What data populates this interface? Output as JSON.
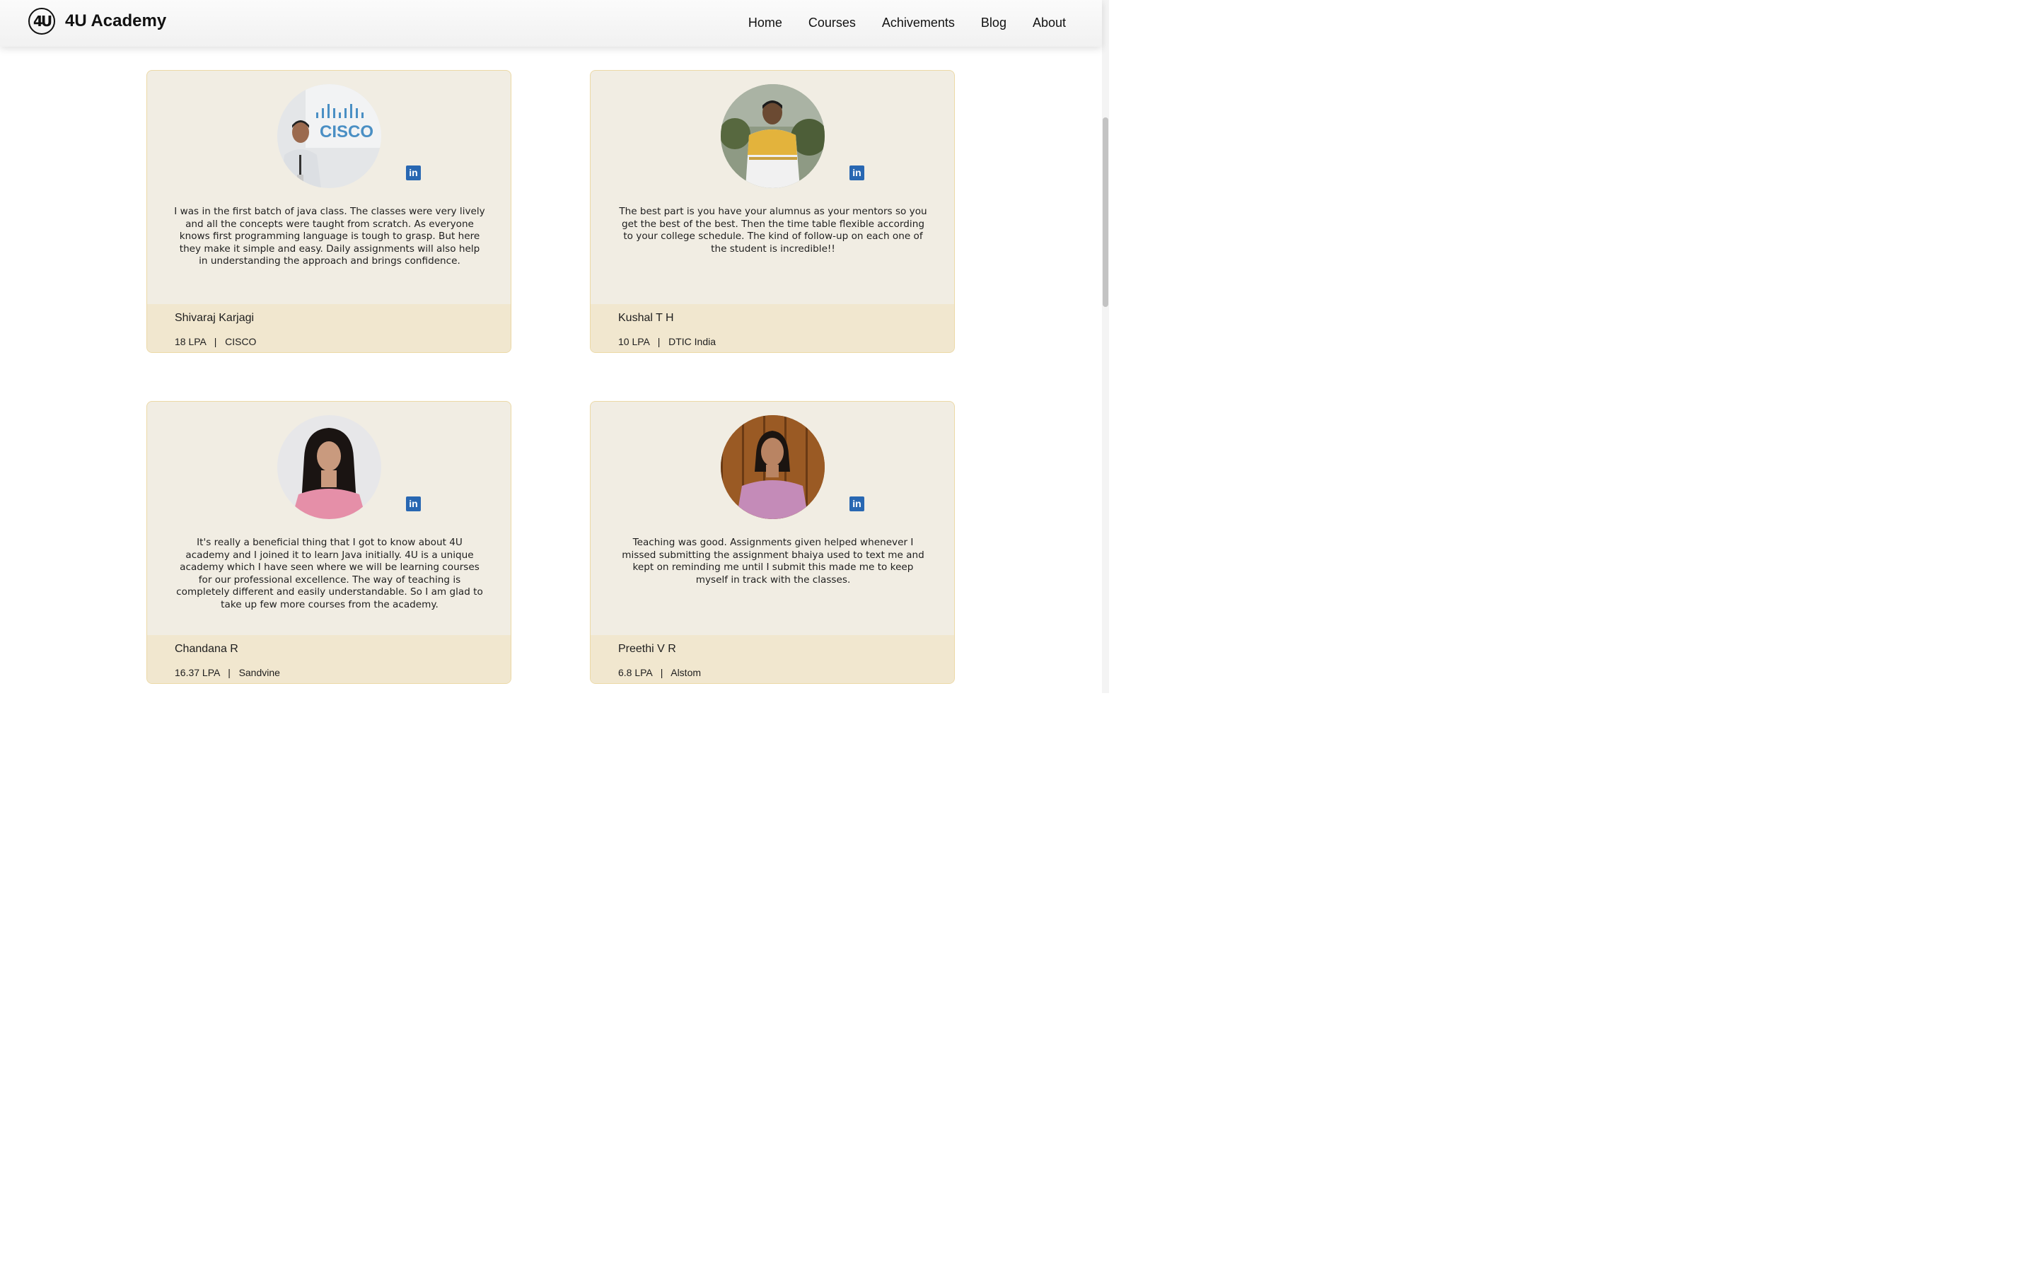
{
  "navbar": {
    "logo_text": "4U",
    "brand": "4U Academy",
    "links": [
      "Home",
      "Courses",
      "Achivements",
      "Blog",
      "About"
    ]
  },
  "linkedin_icon": "linkedin-icon",
  "accent_colors": {
    "card_bg": "#f1ede3",
    "card_border": "#ecd9a6",
    "footer_bg": "#f1e7cf",
    "linkedin": "#2867b2"
  },
  "testimonials": [
    {
      "photo": "Shivaraj Karjagi photo with CISCO logo background",
      "quote": "I was in the first batch of java class. The classes were very lively and all the concepts were taught from scratch. As everyone knows first programming language is tough to grasp. But here they make it simple and easy. Daily assignments will also help in understanding the approach and brings confidence.",
      "name": "Shivaraj Karjagi",
      "package": "18 LPA",
      "separator": "|",
      "company": "CISCO",
      "cisco_logo_text": "CISCO"
    },
    {
      "photo": "Kushal T H photo",
      "quote": "The best part is you have your alumnus as your mentors so you get the best of the best. Then the time table flexible according to your college schedule. The kind of follow-up on each one of the student is incredible!!",
      "name": "Kushal T H",
      "package": "10 LPA",
      "separator": "|",
      "company": "DTIC India"
    },
    {
      "photo": "Chandana R photo",
      "quote": "It's really a beneficial thing that I got to know about 4U academy and I joined it to learn Java initially. 4U is a unique academy which I have seen where we will be learning courses for our professional excellence. The way of teaching is completely different and easily understandable. So I am glad to take up few more courses from the academy.",
      "name": "Chandana R",
      "package": "16.37 LPA",
      "separator": "|",
      "company": "Sandvine"
    },
    {
      "photo": "Preethi V R photo",
      "quote": "Teaching was good. Assignments given helped whenever I missed submitting the assignment bhaiya used to text me and kept on reminding me until I submit this made me to keep myself in track with the classes.",
      "name": "Preethi V R",
      "package": "6.8 LPA",
      "separator": "|",
      "company": "Alstom"
    }
  ]
}
